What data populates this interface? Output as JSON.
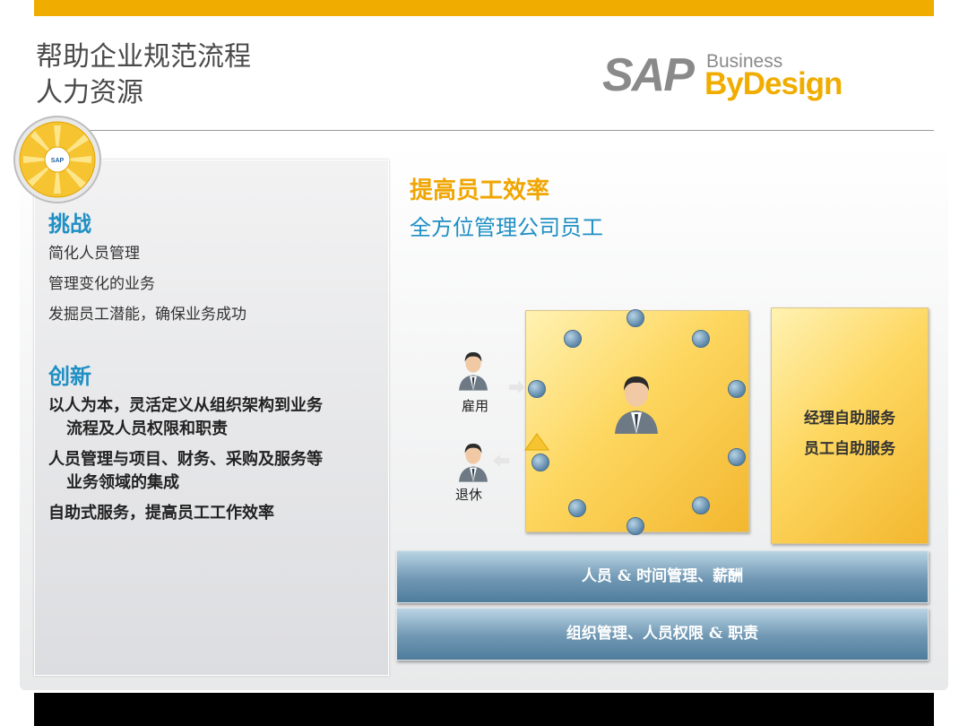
{
  "slide": {
    "title_line1": "帮助企业规范流程",
    "title_line2": "人力资源"
  },
  "logo": {
    "sap": "SAP",
    "business": "Business",
    "bydesign": "ByDesign"
  },
  "left_panel": {
    "challenge_heading": "挑战",
    "challenges": [
      "简化人员管理",
      "管理变化的业务",
      "发掘员工潜能，确保业务成功"
    ],
    "innovation_heading": "创新",
    "innovations": [
      {
        "line1": "以人为本，灵活定义从组织架构到业务",
        "line2": "流程及人员权限和职责"
      },
      {
        "line1": "人员管理与项目、财务、采购及服务等",
        "line2": "业务领域的集成"
      },
      {
        "line1": "自助式服务，提高员工工作效率",
        "line2": ""
      }
    ]
  },
  "right_panel": {
    "headline": "提高员工效率",
    "subheadline": "全方位管理公司员工",
    "hire_label": "雇用",
    "retire_label": "退休",
    "self_service_1": "经理自助服务",
    "self_service_2": "员工自助服务",
    "bar1": "人员 & 时间管理、薪酬",
    "bar2": "组织管理、人员权限 & 职责"
  },
  "colors": {
    "accent_orange": "#f0ad00",
    "accent_blue": "#1f8fc4"
  }
}
